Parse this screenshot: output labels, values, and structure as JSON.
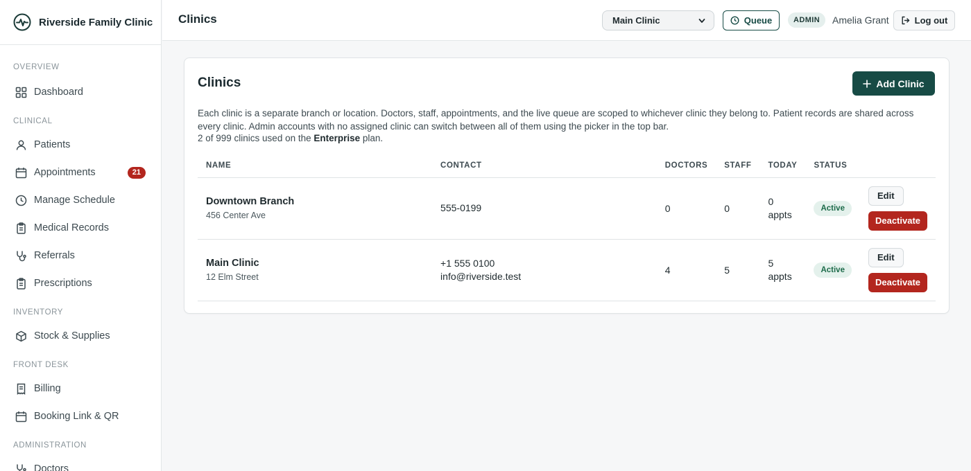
{
  "app": {
    "name": "Riverside Family Clinic",
    "logo_icon": "heartbeat-icon",
    "accent": "#174b45",
    "danger": "#b3261e"
  },
  "sidebar": {
    "sections": [
      {
        "title": "OVERVIEW",
        "items": [
          {
            "label": "Dashboard",
            "icon": "grid-icon"
          }
        ]
      },
      {
        "title": "CLINICAL",
        "items": [
          {
            "label": "Patients",
            "icon": "user-icon"
          },
          {
            "label": "Appointments",
            "icon": "calendar-icon",
            "badge": "21"
          },
          {
            "label": "Manage Schedule",
            "icon": "clock-icon"
          },
          {
            "label": "Medical Records",
            "icon": "clipboard-icon"
          },
          {
            "label": "Referrals",
            "icon": "stethoscope-icon"
          },
          {
            "label": "Prescriptions",
            "icon": "clipboard-icon"
          }
        ]
      },
      {
        "title": "INVENTORY",
        "items": [
          {
            "label": "Stock & Supplies",
            "icon": "box-icon"
          }
        ]
      },
      {
        "title": "FRONT DESK",
        "items": [
          {
            "label": "Billing",
            "icon": "receipt-icon"
          },
          {
            "label": "Booking Link & QR",
            "icon": "calendar-icon"
          }
        ]
      },
      {
        "title": "ADMINISTRATION",
        "items": [
          {
            "label": "Doctors",
            "icon": "stethoscope-icon"
          }
        ]
      }
    ]
  },
  "topbar": {
    "title": "Clinics",
    "clinic_select": {
      "value": "Main Clinic"
    },
    "queue_label": "Queue",
    "role_badge": "ADMIN",
    "user_name": "Amelia Grant",
    "logout_label": "Log out"
  },
  "main": {
    "title": "Clinics",
    "add_label": "Add Clinic",
    "description": "Each clinic is a separate branch or location. Doctors, staff, appointments, and the live queue are scoped to whichever clinic they belong to. Patient records are shared across every clinic. Admin accounts with no assigned clinic can switch between all of them using the picker in the top bar.",
    "plan": {
      "prefix": "2 of 999 clinics used on the ",
      "name": "Enterprise",
      "suffix": " plan."
    },
    "table": {
      "columns": [
        "NAME",
        "CONTACT",
        "DOCTORS",
        "STAFF",
        "TODAY",
        "STATUS",
        ""
      ],
      "rows": [
        {
          "name": "Downtown Branch",
          "address": "456 Center Ave",
          "contact": [
            "555-0199"
          ],
          "doctors": "0",
          "staff": "0",
          "today": "0 appts",
          "status": "Active",
          "edit": "Edit",
          "deactivate": "Deactivate"
        },
        {
          "name": "Main Clinic",
          "address": "12 Elm Street",
          "contact": [
            "+1 555 0100",
            "info@riverside.test"
          ],
          "doctors": "4",
          "staff": "5",
          "today": "5 appts",
          "status": "Active",
          "edit": "Edit",
          "deactivate": "Deactivate"
        }
      ]
    }
  }
}
